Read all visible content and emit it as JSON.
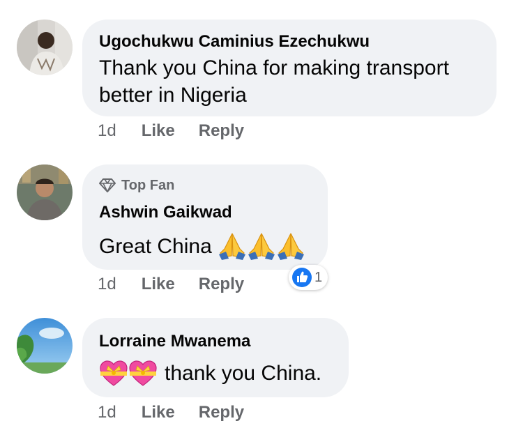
{
  "comments": [
    {
      "author": "Ugochukwu Caminius Ezechukwu",
      "text_lines": [
        "Thank you China for making transport",
        "better in Nigeria"
      ],
      "time": "1d",
      "like_label": "Like",
      "reply_label": "Reply"
    },
    {
      "badge": "Top Fan",
      "author": "Ashwin Gaikwad",
      "text": "Great China",
      "emojis": [
        "folded-hands",
        "folded-hands",
        "folded-hands"
      ],
      "time": "1d",
      "like_label": "Like",
      "reply_label": "Reply",
      "reaction": {
        "icon": "thumbs-up-reaction",
        "count": "1",
        "color": "#1877f2"
      }
    },
    {
      "author": "Lorraine Mwanema",
      "emojis": [
        "heart-with-ribbon",
        "heart-with-ribbon"
      ],
      "text": "thank you China.",
      "time": "1d",
      "like_label": "Like",
      "reply_label": "Reply"
    }
  ],
  "colors": {
    "bubble": "#f0f2f5",
    "secondary_text": "#65676b",
    "primary_text": "#050505",
    "like_blue": "#1877f2"
  }
}
